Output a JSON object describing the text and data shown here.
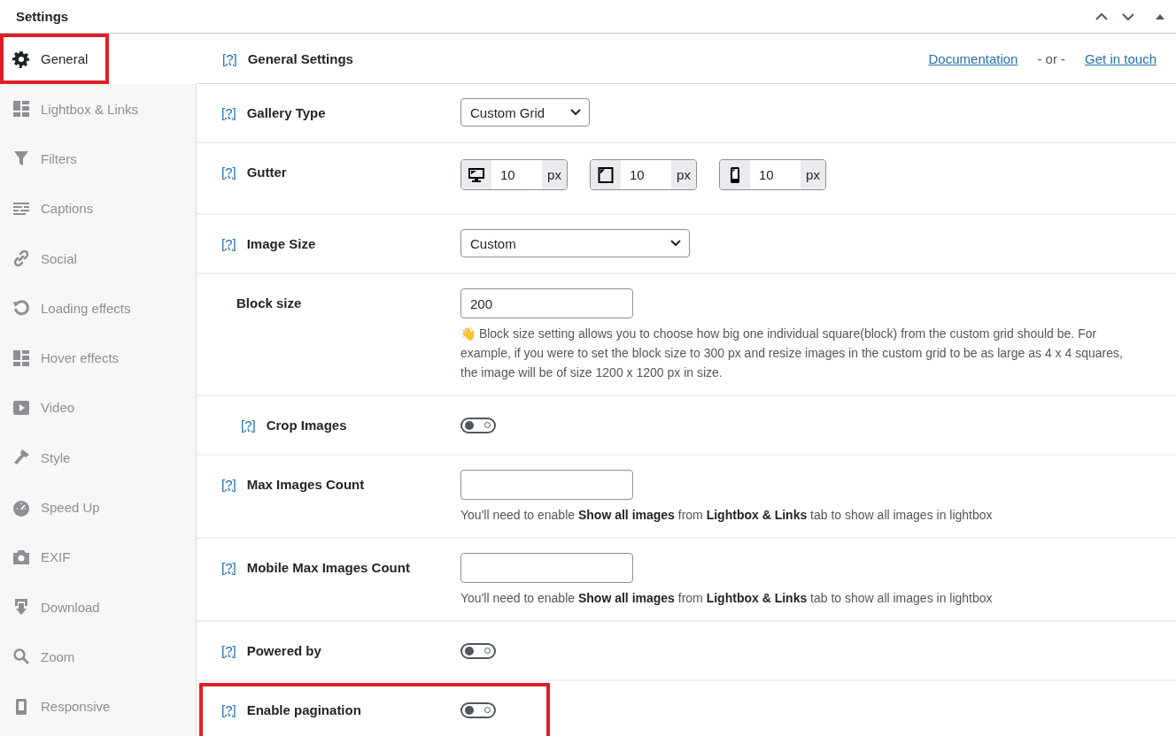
{
  "panel": {
    "title": "Settings"
  },
  "sidebar": {
    "items": [
      {
        "label": "General",
        "selected": true,
        "highlighted": true
      },
      {
        "label": "Lightbox & Links",
        "selected": false,
        "highlighted": false
      },
      {
        "label": "Filters",
        "selected": false,
        "highlighted": false
      },
      {
        "label": "Captions",
        "selected": false,
        "highlighted": false
      },
      {
        "label": "Social",
        "selected": false,
        "highlighted": false
      },
      {
        "label": "Loading effects",
        "selected": false,
        "highlighted": false
      },
      {
        "label": "Hover effects",
        "selected": false,
        "highlighted": false
      },
      {
        "label": "Video",
        "selected": false,
        "highlighted": false
      },
      {
        "label": "Style",
        "selected": false,
        "highlighted": false
      },
      {
        "label": "Speed Up",
        "selected": false,
        "highlighted": false
      },
      {
        "label": "EXIF",
        "selected": false,
        "highlighted": false
      },
      {
        "label": "Download",
        "selected": false,
        "highlighted": false
      },
      {
        "label": "Zoom",
        "selected": false,
        "highlighted": false
      },
      {
        "label": "Responsive",
        "selected": false,
        "highlighted": false
      }
    ]
  },
  "header": {
    "help": "[?]",
    "title": "General Settings",
    "links": [
      "Documentation",
      "Get in touch"
    ],
    "separator": "- or -"
  },
  "rows": [
    {
      "kind": "select",
      "help": "[?]",
      "label": "Gallery Type",
      "value": "Custom Grid",
      "wide": false,
      "highlighted": false
    },
    {
      "kind": "gutter",
      "help": "[?]",
      "label": "Gutter",
      "highlighted": false,
      "fields": [
        {
          "value": "10",
          "unit": "px"
        },
        {
          "value": "10",
          "unit": "px"
        },
        {
          "value": "10",
          "unit": "px"
        }
      ]
    },
    {
      "kind": "select",
      "help": "[?]",
      "label": "Image Size",
      "value": "Custom",
      "wide": true,
      "highlighted": false,
      "children": [
        {
          "kind": "text",
          "label": "Block size",
          "value": "200",
          "highlighted": false,
          "note": "👋 Block size setting allows you to choose how big one individual square(block) from the custom grid should be. For example, if you were to set the block size to 300 px and resize images in the custom grid to be as large as 4 x 4 squares, the image will be of size 1200 x 1200 px in size."
        },
        {
          "kind": "toggle",
          "help": "[?]",
          "label": "Crop Images",
          "on": false,
          "highlighted": false
        }
      ]
    },
    {
      "kind": "text",
      "help": "[?]",
      "label": "Max Images Count",
      "value": "",
      "highlighted": false,
      "note": "You'll need to enable **Show all images** from **Lightbox & Links** tab to show all images in lightbox"
    },
    {
      "kind": "text",
      "help": "[?]",
      "label": "Mobile Max Images Count",
      "value": "",
      "highlighted": false,
      "note": "You'll need to enable **Show all images** from **Lightbox & Links** tab to show all images in lightbox"
    },
    {
      "kind": "toggle",
      "help": "[?]",
      "label": "Powered by",
      "on": false,
      "highlighted": false
    },
    {
      "kind": "toggle",
      "help": "[?]",
      "label": "Enable pagination",
      "on": false,
      "highlighted": true
    }
  ]
}
